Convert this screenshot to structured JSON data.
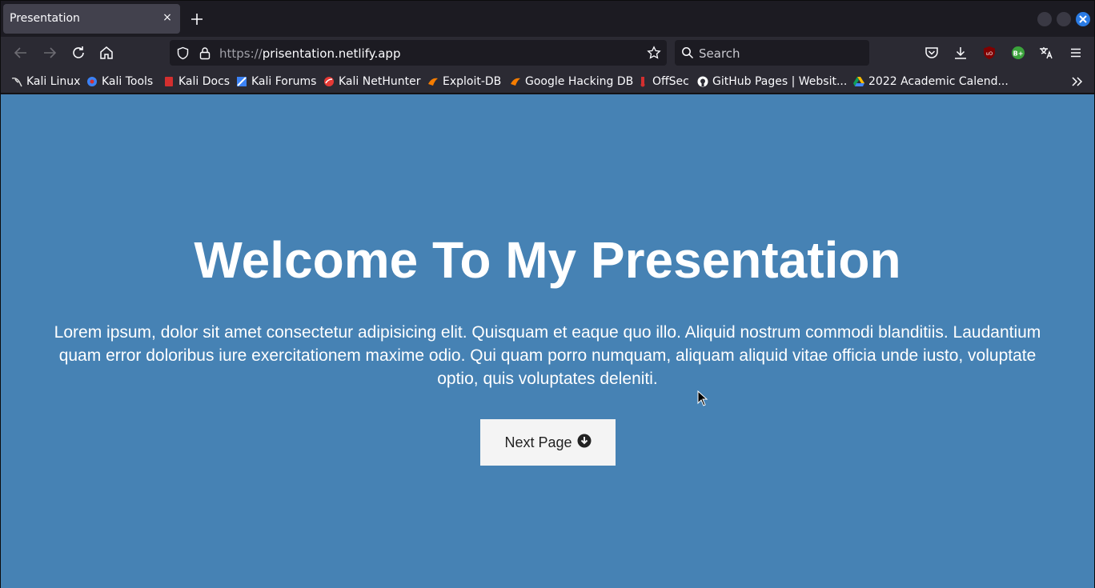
{
  "browser": {
    "tab": {
      "title": "Presentation",
      "close_glyph": "×"
    },
    "new_tab_icon": "plus-icon",
    "url": {
      "protocol": "https://",
      "host": "prisentation.netlify.app"
    },
    "search": {
      "placeholder": "Search"
    },
    "bookmarks": [
      {
        "label": "Kali Linux",
        "icon": "kali-dragon-icon",
        "color": "#dddddd"
      },
      {
        "label": "Kali Tools",
        "icon": "kali-tools-icon",
        "color": "#3b82f6"
      },
      {
        "label": "Kali Docs",
        "icon": "kali-docs-icon",
        "color": "#d32f2f"
      },
      {
        "label": "Kali Forums",
        "icon": "kali-forums-icon",
        "color": "#3b82f6"
      },
      {
        "label": "Kali NetHunter",
        "icon": "nethunter-icon",
        "color": "#e53935"
      },
      {
        "label": "Exploit-DB",
        "icon": "exploit-db-icon",
        "color": "#f57c00"
      },
      {
        "label": "Google Hacking DB",
        "icon": "ghdb-icon",
        "color": "#f57c00"
      },
      {
        "label": "OffSec",
        "icon": "offsec-icon",
        "color": "#d32f2f"
      },
      {
        "label": "GitHub Pages | Websit...",
        "icon": "github-icon",
        "color": "#ffffff"
      },
      {
        "label": "2022 Academic Calend...",
        "icon": "google-drive-icon",
        "color": "#fbbc04"
      }
    ]
  },
  "page": {
    "title": "Welcome To My Presentation",
    "text": "Lorem ipsum, dolor sit amet consectetur adipisicing elit. Quisquam et eaque quo illo. Aliquid nostrum commodi blanditiis. Laudantium quam error doloribus iure exercitationem maxime odio. Qui quam porro numquam, aliquam aliquid vitae officia unde iusto, voluptate optio, quis voluptates deleniti.",
    "next_button": "Next Page",
    "background_color": "#4682b4"
  }
}
